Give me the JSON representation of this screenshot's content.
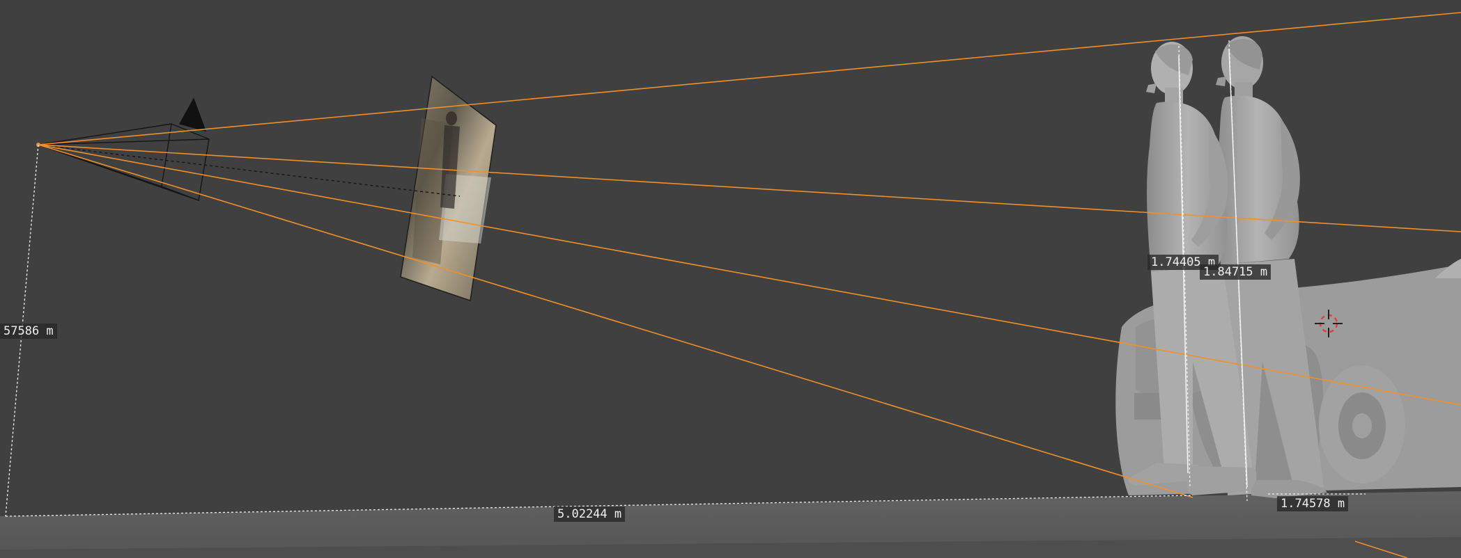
{
  "viewport": {
    "background": "#404040",
    "floor_color": "#5b5b5b",
    "ray_color": "#f0902a",
    "model_color": "#a9a9a9"
  },
  "measurements": {
    "camera_height": "57586 m",
    "floor_distance": "5.02244 m",
    "figure_front_height": "1.74405 m",
    "figure_back_height": "1.84715 m",
    "figure_spacing": "1.74578 m"
  },
  "icons": {
    "camera": "camera-gizmo-icon",
    "cursor": "3d-cursor-icon"
  }
}
